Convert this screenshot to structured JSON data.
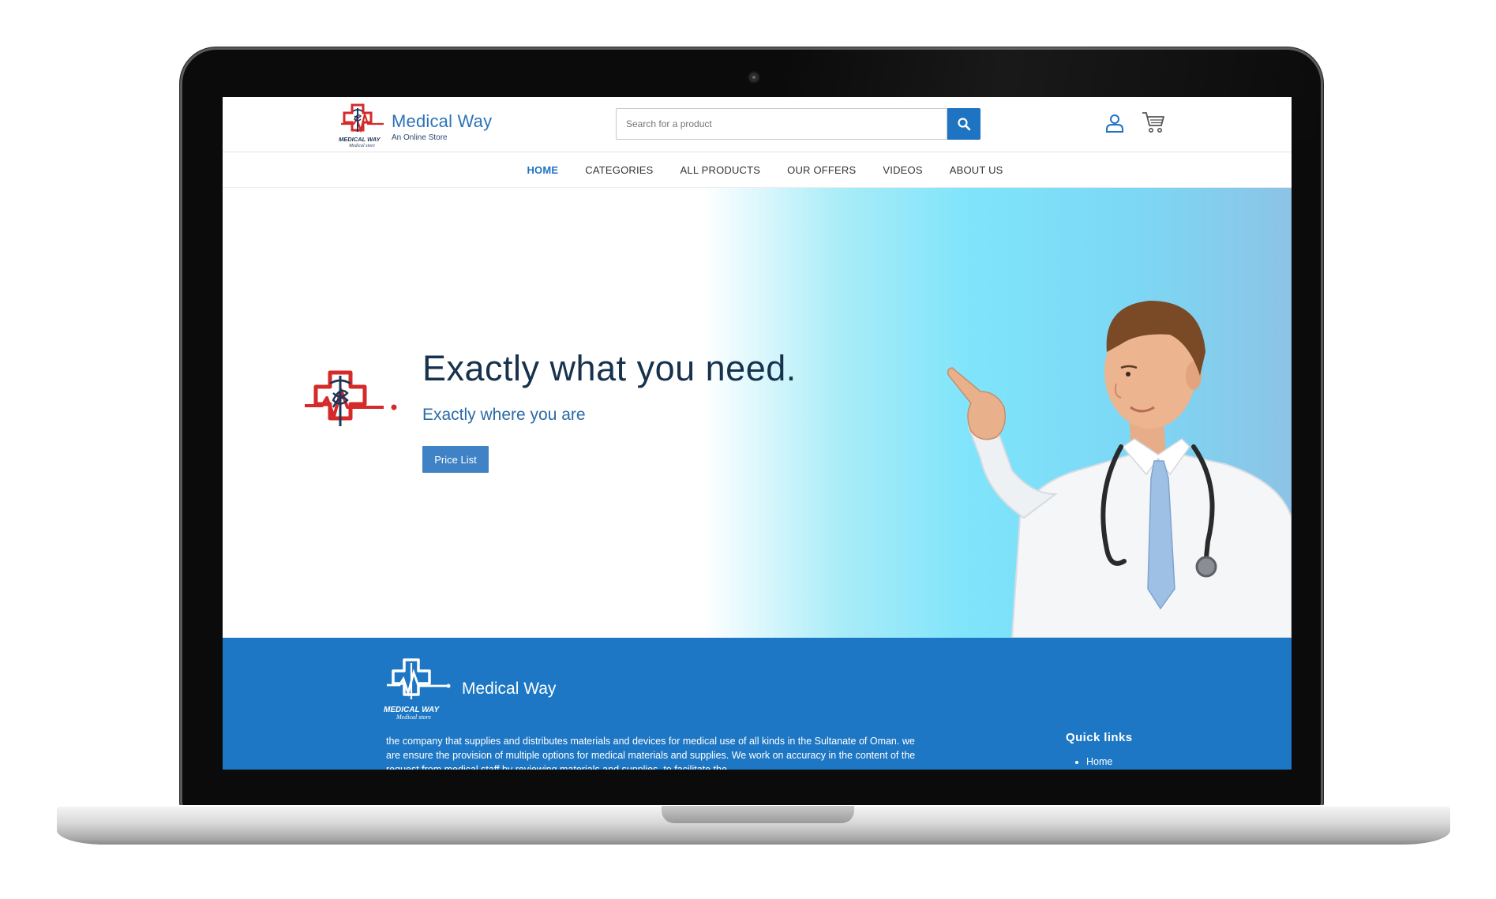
{
  "header": {
    "brand_name": "Medical Way",
    "brand_tagline": "An Online Store",
    "search_placeholder": "Search for a product"
  },
  "nav": {
    "items": [
      {
        "label": "HOME",
        "active": true
      },
      {
        "label": "CATEGORIES",
        "active": false
      },
      {
        "label": "ALL PRODUCTS",
        "active": false
      },
      {
        "label": "OUR OFFERS",
        "active": false
      },
      {
        "label": "VIDEOS",
        "active": false
      },
      {
        "label": "ABOUT US",
        "active": false
      }
    ]
  },
  "hero": {
    "title": "Exactly what you need.",
    "subtitle": "Exactly where you are",
    "cta_label": "Price List"
  },
  "logo_text": {
    "line1": "MEDICAL WAY",
    "line2": "Medical store"
  },
  "footer": {
    "brand_name": "Medical Way",
    "about": "the company that supplies and distributes materials and devices for medical use of all kinds in the Sultanate of Oman. we are ensure the provision of multiple options for medical materials and supplies. We work on accuracy in the content of the request from medical staff by reviewing materials and supplies, to facilitate the",
    "quick_links_title": "Quick links",
    "quick_links": [
      "Home"
    ]
  },
  "colors": {
    "brand_blue": "#1e73c3",
    "footer_blue": "#1e77c4",
    "logo_red": "#d62a2a",
    "logo_navy": "#1d3557"
  },
  "icons": {
    "search": "search-icon",
    "user": "user-icon",
    "cart": "cart-icon"
  }
}
